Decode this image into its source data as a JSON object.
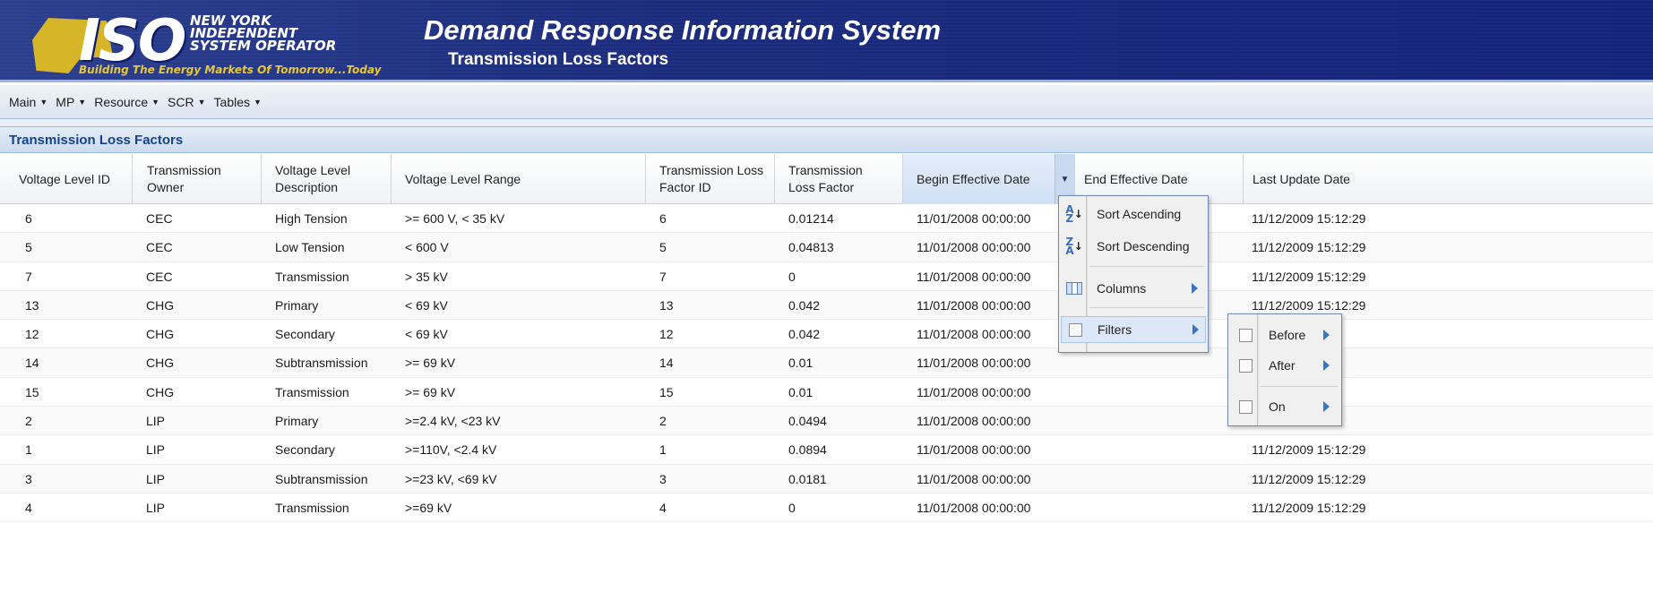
{
  "header": {
    "logo": {
      "iso": "ISO",
      "org_line1": "NEW YORK",
      "org_line2": "INDEPENDENT",
      "org_line3": "SYSTEM OPERATOR",
      "tagline": "Building The Energy Markets Of Tomorrow...Today"
    },
    "app_title": "Demand Response Information System",
    "page_subtitle": "Transmission Loss Factors"
  },
  "menubar": {
    "items": [
      {
        "label": "Main"
      },
      {
        "label": "MP"
      },
      {
        "label": "Resource"
      },
      {
        "label": "SCR"
      },
      {
        "label": "Tables"
      }
    ]
  },
  "panel": {
    "title": "Transmission Loss Factors"
  },
  "grid": {
    "columns": [
      {
        "key": "voltage_level_id",
        "label": "Voltage Level ID"
      },
      {
        "key": "transmission_owner",
        "label": "Transmission Owner"
      },
      {
        "key": "voltage_level_description",
        "label": "Voltage Level Description"
      },
      {
        "key": "voltage_level_range",
        "label": "Voltage Level Range"
      },
      {
        "key": "tlf_id",
        "label": "Transmission Loss Factor ID"
      },
      {
        "key": "tlf",
        "label": "Transmission Loss Factor"
      },
      {
        "key": "begin_effective_date",
        "label": "Begin Effective Date"
      },
      {
        "key": "end_effective_date",
        "label": "End Effective Date"
      },
      {
        "key": "last_update_date",
        "label": "Last Update Date"
      }
    ],
    "rows": [
      [
        "6",
        "CEC",
        "High Tension",
        ">= 600 V, < 35 kV",
        "6",
        "0.01214",
        "11/01/2008 00:00:00",
        "",
        "11/12/2009 15:12:29"
      ],
      [
        "5",
        "CEC",
        "Low Tension",
        "< 600 V",
        "5",
        "0.04813",
        "11/01/2008 00:00:00",
        "",
        "11/12/2009 15:12:29"
      ],
      [
        "7",
        "CEC",
        "Transmission",
        "> 35 kV",
        "7",
        "0",
        "11/01/2008 00:00:00",
        "",
        "11/12/2009 15:12:29"
      ],
      [
        "13",
        "CHG",
        "Primary",
        "< 69 kV",
        "13",
        "0.042",
        "11/01/2008 00:00:00",
        "",
        "11/12/2009 15:12:29"
      ],
      [
        "12",
        "CHG",
        "Secondary",
        "< 69 kV",
        "12",
        "0.042",
        "11/01/2008 00:00:00",
        "",
        "12:29"
      ],
      [
        "14",
        "CHG",
        "Subtransmission",
        ">= 69 kV",
        "14",
        "0.01",
        "11/01/2008 00:00:00",
        "",
        "12:29"
      ],
      [
        "15",
        "CHG",
        "Transmission",
        ">= 69 kV",
        "15",
        "0.01",
        "11/01/2008 00:00:00",
        "",
        "12:29"
      ],
      [
        "2",
        "LIP",
        "Primary",
        ">=2.4 kV, <23 kV",
        "2",
        "0.0494",
        "11/01/2008 00:00:00",
        "",
        "12:29"
      ],
      [
        "1",
        "LIP",
        "Secondary",
        ">=110V, <2.4 kV",
        "1",
        "0.0894",
        "11/01/2008 00:00:00",
        "",
        "11/12/2009 15:12:29"
      ],
      [
        "3",
        "LIP",
        "Subtransmission",
        ">=23 kV, <69 kV",
        "3",
        "0.0181",
        "11/01/2008 00:00:00",
        "",
        "11/12/2009 15:12:29"
      ],
      [
        "4",
        "LIP",
        "Transmission",
        ">=69 kV",
        "4",
        "0",
        "11/01/2008 00:00:00",
        "",
        "11/12/2009 15:12:29"
      ]
    ]
  },
  "column_menu": {
    "sort_ascending": "Sort Ascending",
    "sort_descending": "Sort Descending",
    "columns": "Columns",
    "filters": "Filters"
  },
  "filter_submenu": {
    "before": "Before",
    "after": "After",
    "on": "On"
  },
  "colors": {
    "banner": "#1b2c7e",
    "panel_title": "#15428b",
    "menu_border": "#718bb7",
    "arrow": "#3a75c4"
  }
}
